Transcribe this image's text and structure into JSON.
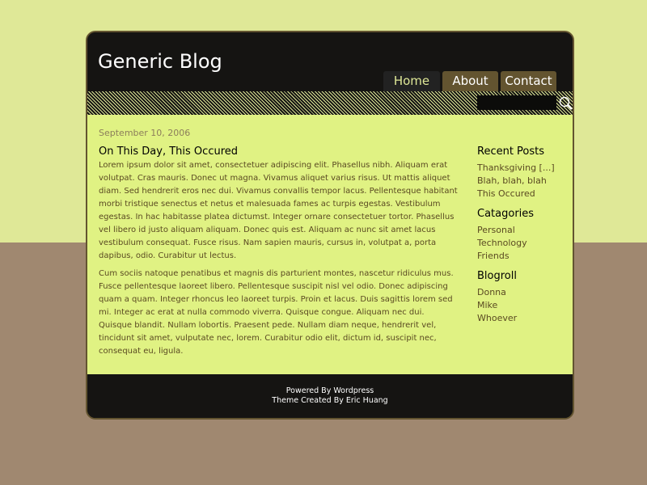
{
  "header": {
    "title": "Generic Blog",
    "nav": [
      "Home",
      "About",
      "Contact"
    ],
    "search_placeholder": ""
  },
  "post": {
    "date": "September 10, 2006",
    "title": "On This Day, This Occured",
    "paragraphs": [
      "Lorem ipsum dolor sit amet, consectetuer adipiscing elit. Phasellus nibh. Aliquam erat volutpat. Cras mauris. Donec ut magna. Vivamus aliquet varius risus. Ut mattis aliquet diam. Sed hendrerit eros nec dui. Vivamus convallis tempor lacus. Pellentesque habitant morbi tristique senectus et netus et malesuada fames ac turpis egestas. Vestibulum egestas. In hac habitasse platea dictumst. Integer ornare consectetuer tortor. Phasellus vel libero id justo aliquam aliquam. Donec quis est. Aliquam ac nunc sit amet lacus vestibulum consequat. Fusce risus. Nam sapien mauris, cursus in, volutpat a, porta dapibus, odio. Curabitur ut lectus.",
      "Cum sociis natoque penatibus et magnis dis parturient montes, nascetur ridiculus mus. Fusce pellentesque laoreet libero. Pellentesque suscipit nisl vel odio. Donec adipiscing quam a quam. Integer rhoncus leo laoreet turpis. Proin et lacus. Duis sagittis lorem sed mi. Integer ac erat at nulla commodo viverra. Quisque congue. Aliquam nec dui. Quisque blandit. Nullam lobortis. Praesent pede. Nullam diam neque, hendrerit vel, tincidunt sit amet, vulputate nec, lorem. Curabitur odio elit, dictum id, suscipit nec, consequat eu, ligula."
    ]
  },
  "sidebar": [
    {
      "heading": "Recent Posts",
      "links": [
        "Thanksgiving [...]",
        "Blah, blah, blah",
        "This Occured"
      ]
    },
    {
      "heading": "Catagories",
      "links": [
        "Personal",
        "Technology",
        "Friends"
      ]
    },
    {
      "heading": "Blogroll",
      "links": [
        "Donna",
        "Mike",
        "Whoever"
      ]
    }
  ],
  "footer": {
    "line1": "Powered By Wordpress",
    "line2": "Theme Created By Eric Huang"
  },
  "colors": {
    "accent": "#dfe897",
    "tab": "#635430",
    "page_bottom": "#a08870"
  }
}
